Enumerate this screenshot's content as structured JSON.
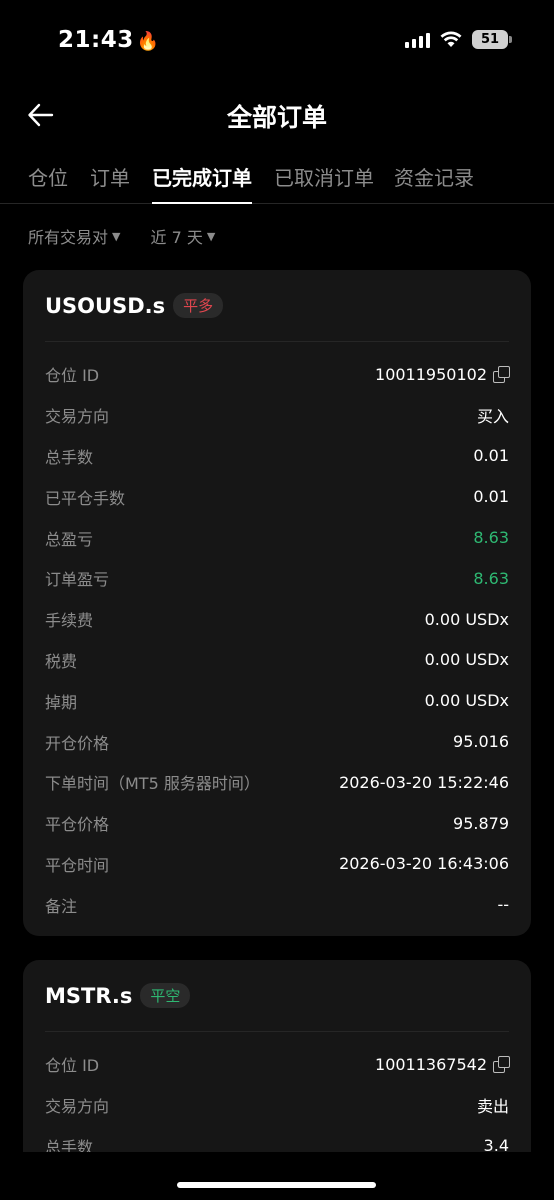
{
  "status_bar": {
    "time": "21:43",
    "battery": "51"
  },
  "header": {
    "title": "全部订单"
  },
  "tabs": [
    {
      "label": "仓位"
    },
    {
      "label": "订单"
    },
    {
      "label": "已完成订单"
    },
    {
      "label": "已取消订单"
    },
    {
      "label": "资金记录"
    }
  ],
  "filters": {
    "pair": "所有交易对",
    "period": "近 7 天"
  },
  "cards": [
    {
      "symbol": "USOUSD.s",
      "badge": "平多",
      "rows": [
        {
          "label": "仓位 ID",
          "value": "10011950102"
        },
        {
          "label": "交易方向",
          "value": "买入"
        },
        {
          "label": "总手数",
          "value": "0.01"
        },
        {
          "label": "已平仓手数",
          "value": "0.01"
        },
        {
          "label": "总盈亏",
          "value": "8.63"
        },
        {
          "label": "订单盈亏",
          "value": "8.63"
        },
        {
          "label": "手续费",
          "value": "0.00 USDx"
        },
        {
          "label": "税费",
          "value": "0.00 USDx"
        },
        {
          "label": "掉期",
          "value": "0.00 USDx"
        },
        {
          "label": "开仓价格",
          "value": "95.016"
        },
        {
          "label": "下单时间（MT5 服务器时间）",
          "value": "2026-03-20 15:22:46"
        },
        {
          "label": "平仓价格",
          "value": "95.879"
        },
        {
          "label": "平仓时间",
          "value": "2026-03-20 16:43:06"
        },
        {
          "label": "备注",
          "value": "--"
        }
      ]
    },
    {
      "symbol": "MSTR.s",
      "badge": "平空",
      "rows": [
        {
          "label": "仓位 ID",
          "value": "10011367542"
        },
        {
          "label": "交易方向",
          "value": "卖出"
        },
        {
          "label": "总手数",
          "value": "3.4"
        }
      ]
    }
  ],
  "colors": {
    "profit": "#2eb872",
    "close_long": "#e0464e",
    "close_short": "#2eb872"
  }
}
